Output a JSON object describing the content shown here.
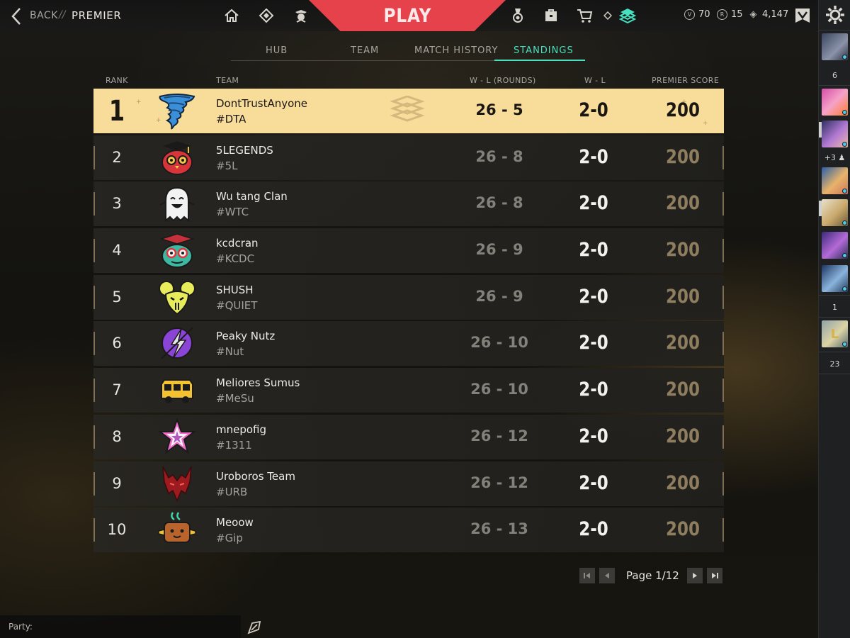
{
  "header": {
    "back_label": "BACK",
    "separator": "//",
    "title": "PREMIER",
    "play_label": "PLAY",
    "currencies": [
      {
        "icon": "valorant-points-icon",
        "symbol": "V",
        "value": "70"
      },
      {
        "icon": "radianite-icon",
        "symbol": "R",
        "value": "15"
      },
      {
        "icon": "kingdom-credits-icon",
        "symbol": "◈",
        "value": "4,147"
      }
    ],
    "accent_color": "#e5424c"
  },
  "tabs": [
    {
      "label": "HUB",
      "active": false
    },
    {
      "label": "TEAM",
      "active": false
    },
    {
      "label": "MATCH HISTORY",
      "active": false
    },
    {
      "label": "STANDINGS",
      "active": true
    }
  ],
  "table": {
    "columns": {
      "rank": "RANK",
      "team": "TEAM",
      "rounds": "W - L (ROUNDS)",
      "wl": "W - L",
      "score": "PREMIER SCORE"
    },
    "rows": [
      {
        "rank": "1",
        "name": "DontTrustAnyone",
        "tag": "#DTA",
        "rounds": "26 - 5",
        "wl": "2-0",
        "score": "200",
        "logo": "tornado-logo"
      },
      {
        "rank": "2",
        "name": "5LEGENDS",
        "tag": "#5L",
        "rounds": "26 - 8",
        "wl": "2-0",
        "score": "200",
        "logo": "graduate-owl-logo"
      },
      {
        "rank": "3",
        "name": "Wu tang Clan",
        "tag": "#WTC",
        "rounds": "26 - 8",
        "wl": "2-0",
        "score": "200",
        "logo": "ghost-logo"
      },
      {
        "rank": "4",
        "name": "kcdcran",
        "tag": "#KCDC",
        "rounds": "26 - 9",
        "wl": "2-0",
        "score": "200",
        "logo": "graduate-cat-logo"
      },
      {
        "rank": "5",
        "name": "SHUSH",
        "tag": "#QUIET",
        "rounds": "26 - 9",
        "wl": "2-0",
        "score": "200",
        "logo": "mouse-logo"
      },
      {
        "rank": "6",
        "name": "Peaky Nutz",
        "tag": "#Nut",
        "rounds": "26 - 10",
        "wl": "2-0",
        "score": "200",
        "logo": "lightning-logo"
      },
      {
        "rank": "7",
        "name": "Meliores Sumus",
        "tag": "#MeSu",
        "rounds": "26 - 10",
        "wl": "2-0",
        "score": "200",
        "logo": "bus-logo"
      },
      {
        "rank": "8",
        "name": "mnepofig",
        "tag": "#1311",
        "rounds": "26 - 12",
        "wl": "2-0",
        "score": "200",
        "logo": "star-logo"
      },
      {
        "rank": "9",
        "name": "Uroboros Team",
        "tag": "#URB",
        "rounds": "26 - 12",
        "wl": "2-0",
        "score": "200",
        "logo": "demon-logo"
      },
      {
        "rank": "10",
        "name": "Meoow",
        "tag": "#Gip",
        "rounds": "26 - 13",
        "wl": "2-0",
        "score": "200",
        "logo": "cat-toast-logo"
      }
    ],
    "highlight_color": "#f8dc9a"
  },
  "pagination": {
    "label": "Page 1/12"
  },
  "party": {
    "label": "Party:"
  },
  "social": {
    "counts": [
      "6",
      "+3",
      "1",
      "23"
    ]
  }
}
